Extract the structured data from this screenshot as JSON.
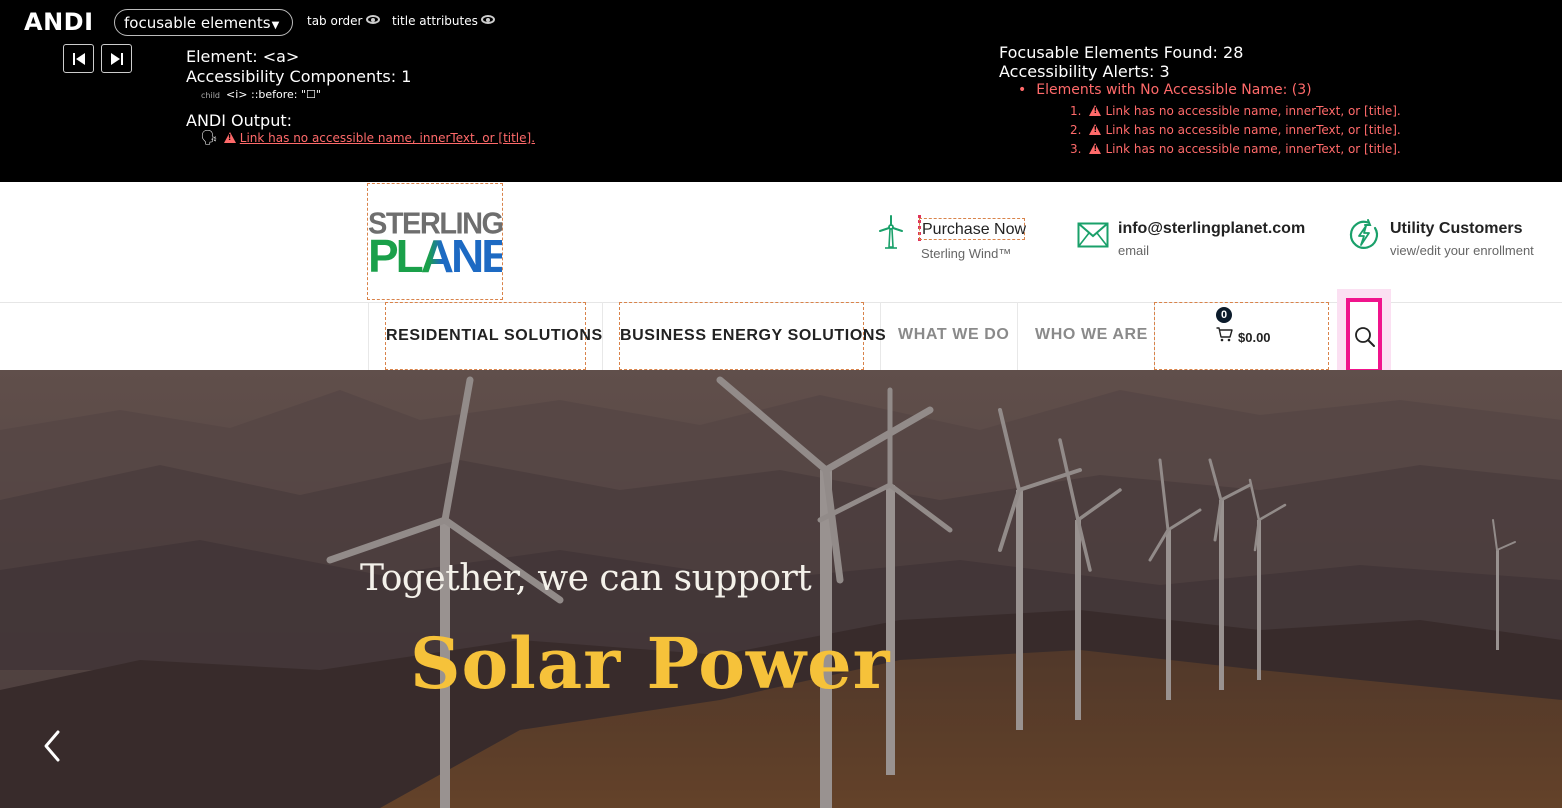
{
  "andi": {
    "logo": "ANDI",
    "mode": "focusable elements",
    "toggle_tab_order": "tab order",
    "toggle_title_attrs": "title attributes",
    "element_line": "Element: <a>",
    "components_line": "Accessibility Components: 1",
    "child_label": "child",
    "child_text": "<i> ::before: \"☐\"",
    "output_heading": "ANDI Output:",
    "output_alert": "Link has no accessible name, innerText, or [title].",
    "found_line": "Focusable Elements Found: 28",
    "alerts_line": "Accessibility Alerts: 3",
    "alerts_group": "Elements with No Accessible Name: (3)",
    "alert_items": [
      {
        "num": "1.",
        "text": "Link has no accessible name, innerText, or [title]."
      },
      {
        "num": "2.",
        "text": "Link has no accessible name, innerText, or [title]."
      },
      {
        "num": "3.",
        "text": "Link has no accessible name, innerText, or [title]."
      }
    ]
  },
  "header": {
    "logo_line1": "STERLING",
    "logo_line2": "PLANET",
    "purchase_title": "Purchase Now",
    "purchase_sub": "Sterling Wind™",
    "email_title": "info@sterlingplanet.com",
    "email_sub": "email",
    "utility_title": "Utility Customers",
    "utility_sub": "view/edit your enrollment"
  },
  "nav": {
    "items": [
      {
        "label": "RESIDENTIAL SOLUTIONS"
      },
      {
        "label": "BUSINESS ENERGY SOLUTIONS"
      },
      {
        "label": "WHAT WE DO"
      },
      {
        "label": "WHO WE ARE"
      }
    ],
    "cart_count": "0",
    "cart_total": "$0.00"
  },
  "hero": {
    "line1": "Together, we can support",
    "line2": "Solar Power"
  },
  "colors": {
    "accent_gold": "#f6c23a",
    "focus_magenta": "#f0148c",
    "brand_green": "#1aa04a",
    "brand_blue": "#1d6ac3",
    "alert_red": "#ff6a6a"
  }
}
